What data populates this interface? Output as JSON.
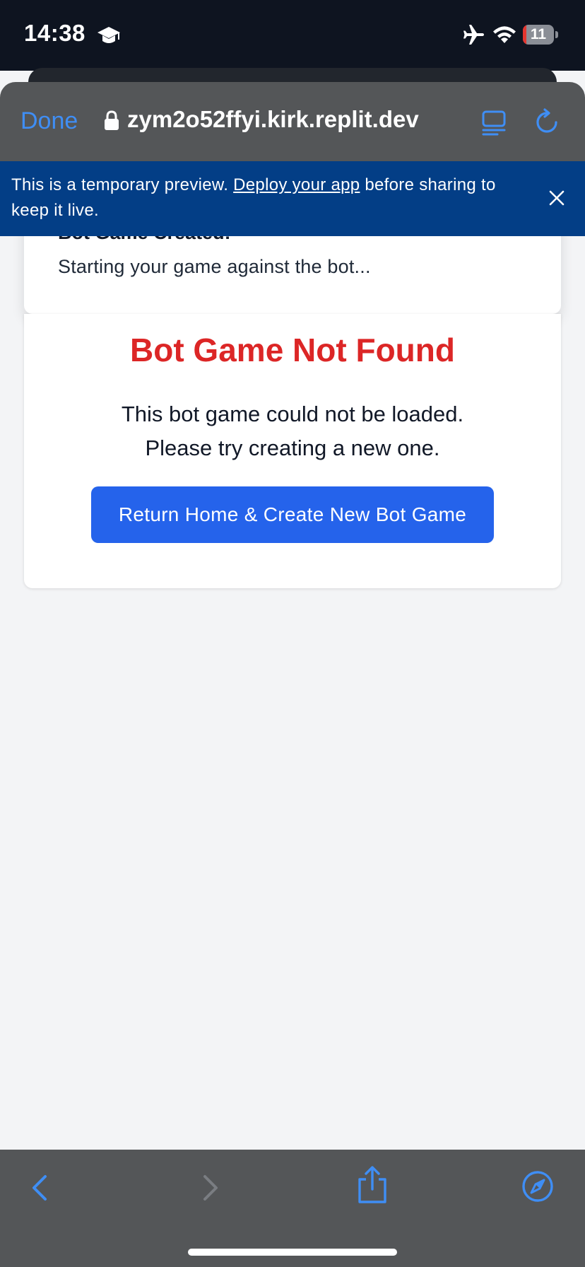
{
  "status_bar": {
    "time": "14:38",
    "battery_level": "11",
    "battery_fraction": 0.11
  },
  "browser": {
    "done_label": "Done",
    "url": "zym2o52ffyi.kirk.replit.dev",
    "accent_color": "#3f8ef5"
  },
  "banner": {
    "text_before": "This is a temporary preview. ",
    "link_text": "Deploy your app",
    "text_after": " before sharing to keep it live.",
    "background_color": "#033e86"
  },
  "toast": {
    "title": "Bot Game Created!",
    "description": "Starting your game against the bot..."
  },
  "main": {
    "error_title": "Bot Game Not Found",
    "error_line_1": "This bot game could not be loaded.",
    "error_line_2": "Please try creating a new one.",
    "button_label": "Return Home & Create New Bot Game",
    "error_color": "#dc2626",
    "button_color": "#2563eb"
  },
  "icons": {
    "status": [
      "graduation-cap-icon",
      "airplane-icon",
      "wifi-icon",
      "battery-icon"
    ],
    "toolbar": [
      "lock-icon",
      "reader-mode-icon",
      "reload-icon"
    ],
    "bottom": [
      "back-icon",
      "forward-icon",
      "share-icon",
      "compass-icon"
    ]
  }
}
